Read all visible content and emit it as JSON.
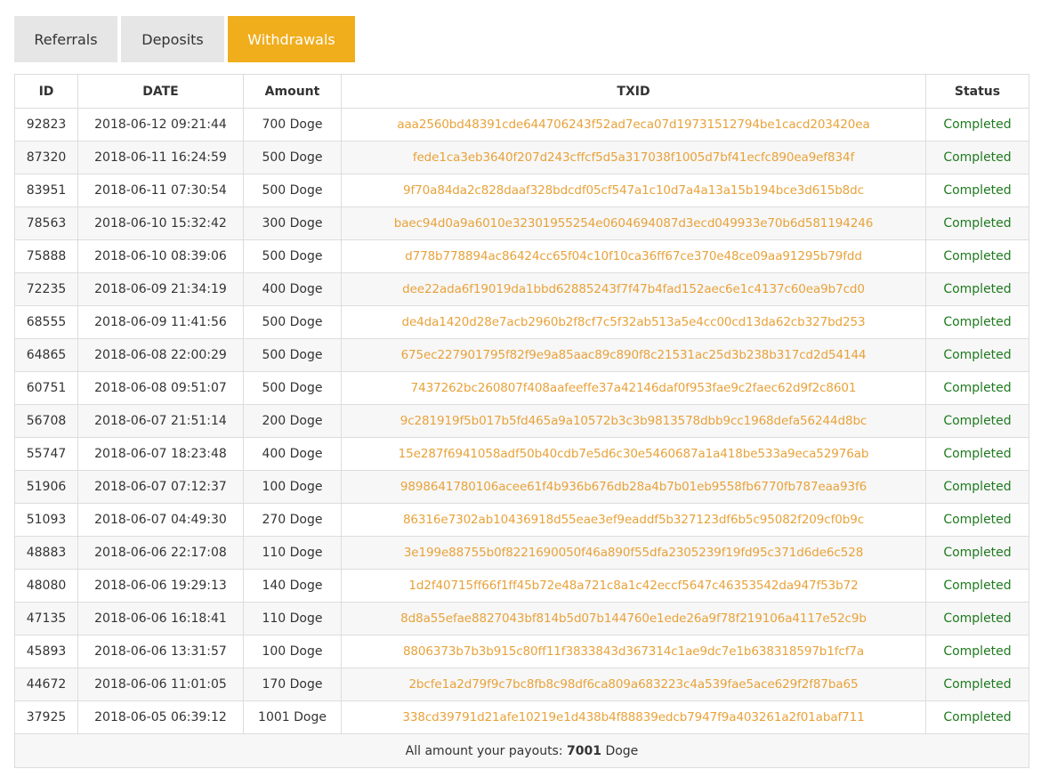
{
  "tabs": [
    {
      "label": "Referrals"
    },
    {
      "label": "Deposits"
    },
    {
      "label": "Withdrawals"
    }
  ],
  "table": {
    "headers": [
      "ID",
      "DATE",
      "Amount",
      "TXID",
      "Status"
    ],
    "rows": [
      {
        "id": "92823",
        "date": "2018-06-12 09:21:44",
        "amount": "700 Doge",
        "txid": "aaa2560bd48391cde644706243f52ad7eca07d19731512794be1cacd203420ea",
        "status": "Completed"
      },
      {
        "id": "87320",
        "date": "2018-06-11 16:24:59",
        "amount": "500 Doge",
        "txid": "fede1ca3eb3640f207d243cffcf5d5a317038f1005d7bf41ecfc890ea9ef834f",
        "status": "Completed"
      },
      {
        "id": "83951",
        "date": "2018-06-11 07:30:54",
        "amount": "500 Doge",
        "txid": "9f70a84da2c828daaf328bdcdf05cf547a1c10d7a4a13a15b194bce3d615b8dc",
        "status": "Completed"
      },
      {
        "id": "78563",
        "date": "2018-06-10 15:32:42",
        "amount": "300 Doge",
        "txid": "baec94d0a9a6010e32301955254e0604694087d3ecd049933e70b6d581194246",
        "status": "Completed"
      },
      {
        "id": "75888",
        "date": "2018-06-10 08:39:06",
        "amount": "500 Doge",
        "txid": "d778b778894ac86424cc65f04c10f10ca36ff67ce370e48ce09aa91295b79fdd",
        "status": "Completed"
      },
      {
        "id": "72235",
        "date": "2018-06-09 21:34:19",
        "amount": "400 Doge",
        "txid": "dee22ada6f19019da1bbd62885243f7f47b4fad152aec6e1c4137c60ea9b7cd0",
        "status": "Completed"
      },
      {
        "id": "68555",
        "date": "2018-06-09 11:41:56",
        "amount": "500 Doge",
        "txid": "de4da1420d28e7acb2960b2f8cf7c5f32ab513a5e4cc00cd13da62cb327bd253",
        "status": "Completed"
      },
      {
        "id": "64865",
        "date": "2018-06-08 22:00:29",
        "amount": "500 Doge",
        "txid": "675ec227901795f82f9e9a85aac89c890f8c21531ac25d3b238b317cd2d54144",
        "status": "Completed"
      },
      {
        "id": "60751",
        "date": "2018-06-08 09:51:07",
        "amount": "500 Doge",
        "txid": "7437262bc260807f408aafeeffe37a42146daf0f953fae9c2faec62d9f2c8601",
        "status": "Completed"
      },
      {
        "id": "56708",
        "date": "2018-06-07 21:51:14",
        "amount": "200 Doge",
        "txid": "9c281919f5b017b5fd465a9a10572b3c3b9813578dbb9cc1968defa56244d8bc",
        "status": "Completed"
      },
      {
        "id": "55747",
        "date": "2018-06-07 18:23:48",
        "amount": "400 Doge",
        "txid": "15e287f6941058adf50b40cdb7e5d6c30e5460687a1a418be533a9eca52976ab",
        "status": "Completed"
      },
      {
        "id": "51906",
        "date": "2018-06-07 07:12:37",
        "amount": "100 Doge",
        "txid": "9898641780106acee61f4b936b676db28a4b7b01eb9558fb6770fb787eaa93f6",
        "status": "Completed"
      },
      {
        "id": "51093",
        "date": "2018-06-07 04:49:30",
        "amount": "270 Doge",
        "txid": "86316e7302ab10436918d55eae3ef9eaddf5b327123df6b5c95082f209cf0b9c",
        "status": "Completed"
      },
      {
        "id": "48883",
        "date": "2018-06-06 22:17:08",
        "amount": "110 Doge",
        "txid": "3e199e88755b0f8221690050f46a890f55dfa2305239f19fd95c371d6de6c528",
        "status": "Completed"
      },
      {
        "id": "48080",
        "date": "2018-06-06 19:29:13",
        "amount": "140 Doge",
        "txid": "1d2f40715ff66f1ff45b72e48a721c8a1c42eccf5647c46353542da947f53b72",
        "status": "Completed"
      },
      {
        "id": "47135",
        "date": "2018-06-06 16:18:41",
        "amount": "110 Doge",
        "txid": "8d8a55efae8827043bf814b5d07b144760e1ede26a9f78f219106a4117e52c9b",
        "status": "Completed"
      },
      {
        "id": "45893",
        "date": "2018-06-06 13:31:57",
        "amount": "100 Doge",
        "txid": "8806373b7b3b915c80ff11f3833843d367314c1ae9dc7e1b638318597b1fcf7a",
        "status": "Completed"
      },
      {
        "id": "44672",
        "date": "2018-06-06 11:01:05",
        "amount": "170 Doge",
        "txid": "2bcfe1a2d79f9c7bc8fb8c98df6ca809a683223c4a539fae5ace629f2f87ba65",
        "status": "Completed"
      },
      {
        "id": "37925",
        "date": "2018-06-05 06:39:12",
        "amount": "1001 Doge",
        "txid": "338cd39791d21afe10219e1d438b4f88839edcb7947f9a403261a2f01abaf711",
        "status": "Completed"
      }
    ]
  },
  "footer": {
    "prefix": "All amount your payouts:",
    "total": "7001",
    "unit": "Doge"
  },
  "colors": {
    "active_tab": "#f0ad1c",
    "txid": "#e8a23a",
    "status_completed": "#1e7a1e"
  }
}
